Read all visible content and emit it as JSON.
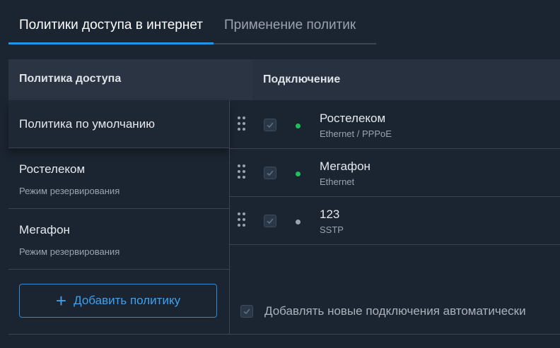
{
  "tabs": [
    {
      "label": "Политики доступа в интернет",
      "active": true
    },
    {
      "label": "Применение политик",
      "active": false
    }
  ],
  "header": {
    "policy_col": "Политика доступа",
    "connection_col": "Подключение"
  },
  "policies": [
    {
      "name": "Политика по умолчанию",
      "subtitle": ""
    },
    {
      "name": "Ростелеком",
      "subtitle": "Режим резервирования"
    },
    {
      "name": "Мегафон",
      "subtitle": "Режим резервирования"
    }
  ],
  "add_policy_label": "Добавить политику",
  "connections": [
    {
      "name": "Ростелеком",
      "type": "Ethernet / PPPoE",
      "checked": true,
      "status_color": "#1fbf5a"
    },
    {
      "name": "Мегафон",
      "type": "Ethernet",
      "checked": true,
      "status_color": "#1fbf5a"
    },
    {
      "name": "123",
      "type": "SSTP",
      "checked": true,
      "status_color": "#9aa3ae"
    }
  ],
  "auto_add_label": "Добавлять новые подключения автоматически",
  "colors": {
    "accent": "#2196e6",
    "background": "#1b2431",
    "online": "#1fbf5a",
    "offline": "#9aa3ae"
  }
}
